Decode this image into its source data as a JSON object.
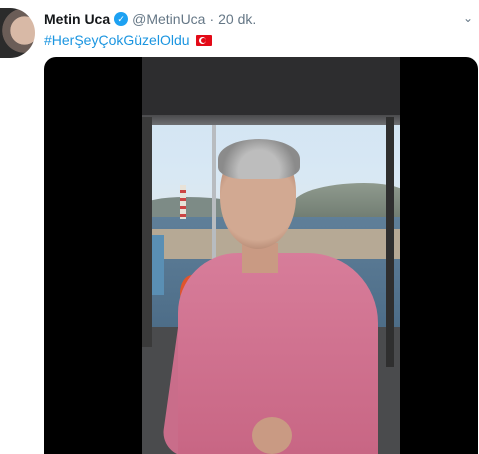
{
  "tweet": {
    "name": "Metin Uca",
    "verified_badge": "✓",
    "handle": "@MetinUca",
    "separator": "·",
    "time": "20 dk.",
    "hashtag": "#HerŞeyÇokGüzelOldu",
    "flag": "turkey-flag",
    "menu_icon": "chevron-down-icon"
  },
  "video": {
    "scene": "man-on-boat-bosphorus",
    "icon": "video-player"
  },
  "colors": {
    "link": "#1b95e0",
    "verified": "#1da1f2",
    "muted": "#657786"
  }
}
